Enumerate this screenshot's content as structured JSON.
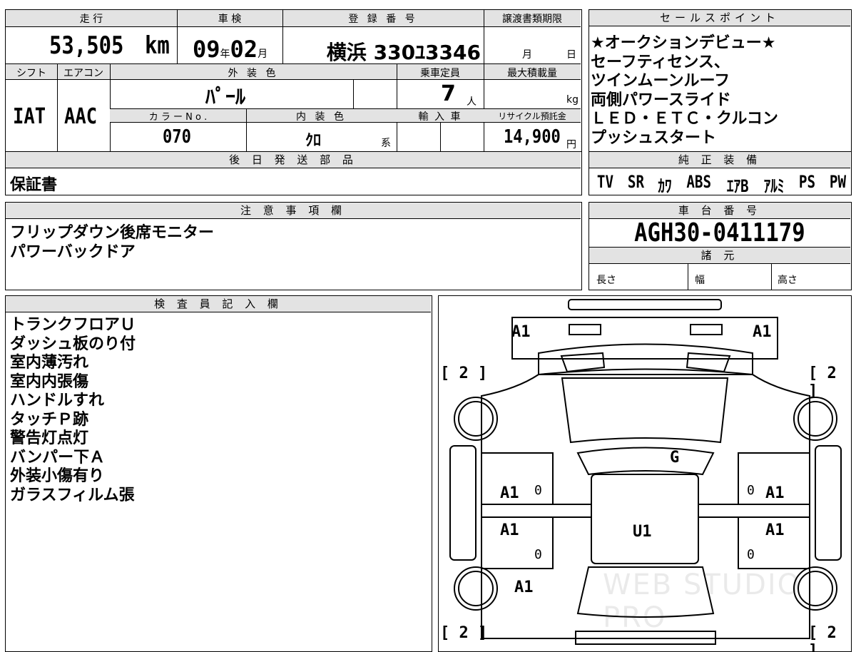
{
  "top_table": {
    "headers": {
      "mileage": "走 行",
      "inspection": "車 検",
      "registration": "登 録 番 号",
      "transfer_deadline": "譲渡書類期限"
    },
    "mileage_value": "53,505",
    "mileage_unit": "km",
    "inspection_year": "09",
    "inspection_year_unit": "年",
    "inspection_month": "02",
    "inspection_month_unit": "月",
    "registration_number": "横浜 330ﾕ3346",
    "transfer_month_unit": "月",
    "transfer_day_unit": "日",
    "row2_headers": {
      "shift": "シフト",
      "aircon": "エアコン",
      "exterior_color": "外 装 色",
      "capacity": "乗車定員",
      "max_load": "最大積載量"
    },
    "shift_value": "IAT",
    "aircon_value": "AAC",
    "exterior_color_value": "ﾊﾟｰﾙ",
    "capacity_value": "7",
    "capacity_unit": "人",
    "max_load_unit": "kg",
    "row3_headers": {
      "color_no": "カ ラ ー N o .",
      "interior_color": "内 装 色",
      "import_car": "輸 入 車",
      "recycle_fee": "リサイクル預託金"
    },
    "color_no_value": "070",
    "interior_color_value": "ｸﾛ",
    "interior_color_suffix": "系",
    "recycle_fee_value": "14,900",
    "recycle_fee_unit": "円"
  },
  "later_shipping": {
    "header": "後 日 発 送 部 品",
    "value": "保証書"
  },
  "notes": {
    "header": "注 意 事 項 欄",
    "lines": [
      "フリップダウン後席モニター",
      "パワーバックドア"
    ]
  },
  "sales_points": {
    "header": "セールスポイント",
    "lines": [
      "★オークションデビュー★",
      "セーフティセンス、",
      "ツインムーンルーフ",
      "両側パワースライド",
      "ＬＥＤ・ＥＴＣ・クルコン",
      "プッシュスタート"
    ]
  },
  "equipment": {
    "header": "純 正 装 備",
    "items": [
      "TV",
      "SR",
      "ｶﾜ",
      "ABS",
      "ｴｱB",
      "ｱﾙﾐ",
      "PS",
      "PW"
    ]
  },
  "chassis": {
    "header": "車 台 番 号",
    "value": "AGH30-0411179",
    "specs_header": "諸 元",
    "length_label": "長さ",
    "width_label": "幅",
    "height_label": "高さ"
  },
  "inspector": {
    "header": "検 査 員 記 入 欄",
    "lines": [
      "トランクフロアＵ",
      "ダッシュ板のり付",
      "室内薄汚れ",
      "室内内張傷",
      "ハンドルすれ",
      "タッチＰ跡",
      "警告灯点灯",
      "バンパー下Ａ",
      "外装小傷有り",
      "ガラスフィルム張"
    ]
  },
  "diagram": {
    "labels": {
      "front_left": "A1",
      "front_right": "A1",
      "bracket_tl": "[ 2 ]",
      "bracket_tr": "[ 2 ]",
      "bracket_bl": "[ 2 ]",
      "bracket_br": "[ 2 ]",
      "hood": "G",
      "door_fl": "A1",
      "door_fr": "A1",
      "door_rl": "A1",
      "door_rr": "A1",
      "roof": "U1",
      "rear_left": "A1",
      "zero": "0"
    },
    "watermark": "WEB STUDIO PRO"
  }
}
